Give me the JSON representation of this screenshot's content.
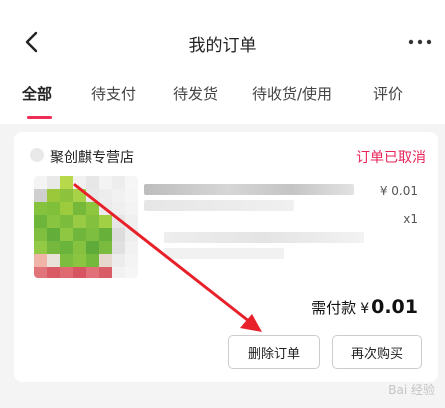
{
  "header": {
    "title": "我的订单",
    "back_icon": "chevron-left-icon",
    "more_icon": "more-horizontal-icon"
  },
  "tabs": [
    {
      "label": "全部",
      "active": true
    },
    {
      "label": "待支付",
      "active": false
    },
    {
      "label": "待发货",
      "active": false
    },
    {
      "label": "待收货/使用",
      "active": false
    },
    {
      "label": "评价",
      "active": false
    }
  ],
  "order": {
    "shop_name": "聚创麒专营店",
    "status": "订单已取消",
    "item_price": "¥ 0.01",
    "item_qty": "x1",
    "total_label": "需付款",
    "total_currency": "¥",
    "total_amount": "0.01",
    "buttons": {
      "delete": "删除订单",
      "rebuy": "再次购买"
    }
  },
  "watermark": "Bai 经验",
  "colors": {
    "accent": "#ef2c55",
    "status": "#e8245a",
    "annotation_arrow": "#e8202a"
  }
}
